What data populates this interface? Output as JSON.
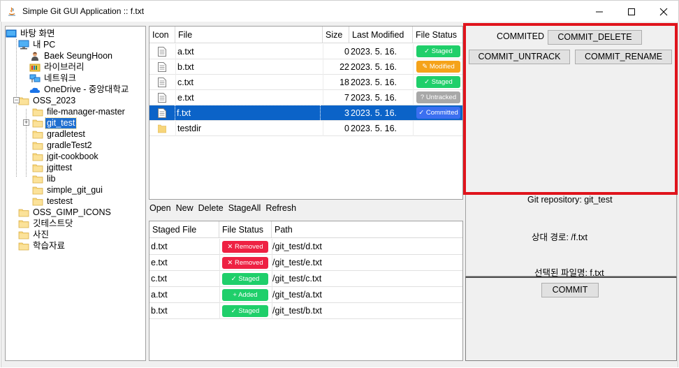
{
  "window": {
    "title": "Simple Git GUI Application :: f.txt",
    "controls": {
      "minimize": "minimize-icon",
      "maximize": "maximize-icon",
      "close": "close-icon"
    }
  },
  "tree": {
    "items": [
      {
        "label": "바탕 화면",
        "icon": "desktop-icon"
      },
      {
        "label": "내 PC",
        "icon": "computer-icon"
      },
      {
        "label": "Baek SeungHoon",
        "icon": "user-icon"
      },
      {
        "label": "라이브러리",
        "icon": "library-icon"
      },
      {
        "label": "네트워크",
        "icon": "network-icon"
      },
      {
        "label": "OneDrive - 중앙대학교",
        "icon": "cloud-icon"
      },
      {
        "label": "OSS_2023",
        "icon": "folder-icon"
      },
      {
        "label": "file-manager-master",
        "icon": "folder-icon"
      },
      {
        "label": "git_test",
        "icon": "folder-icon"
      },
      {
        "label": "gradletest",
        "icon": "folder-icon"
      },
      {
        "label": "gradleTest2",
        "icon": "folder-icon"
      },
      {
        "label": "jgit-cookbook",
        "icon": "folder-icon"
      },
      {
        "label": "jgittest",
        "icon": "folder-icon"
      },
      {
        "label": "lib",
        "icon": "folder-icon"
      },
      {
        "label": "simple_git_gui",
        "icon": "folder-icon"
      },
      {
        "label": "testest",
        "icon": "folder-icon"
      },
      {
        "label": "OSS_GIMP_ICONS",
        "icon": "folder-icon"
      },
      {
        "label": "깃테스트닷",
        "icon": "folder-icon"
      },
      {
        "label": "사진",
        "icon": "folder-icon"
      },
      {
        "label": "학습자료",
        "icon": "folder-icon"
      }
    ]
  },
  "files": {
    "headers": [
      "Icon",
      "File",
      "Size",
      "Last Modified",
      "File Status"
    ],
    "rows": [
      {
        "name": "a.txt",
        "size": "0",
        "modified": "2023. 5. 16.",
        "status": "Staged",
        "type": "file"
      },
      {
        "name": "b.txt",
        "size": "22",
        "modified": "2023. 5. 16.",
        "status": "Modified",
        "type": "file"
      },
      {
        "name": "c.txt",
        "size": "18",
        "modified": "2023. 5. 16.",
        "status": "Staged",
        "type": "file"
      },
      {
        "name": "e.txt",
        "size": "7",
        "modified": "2023. 5. 16.",
        "status": "Untracked",
        "type": "file"
      },
      {
        "name": "f.txt",
        "size": "3",
        "modified": "2023. 5. 16.",
        "status": "Committed",
        "type": "file"
      },
      {
        "name": "testdir",
        "size": "0",
        "modified": "2023. 5. 16.",
        "status": "",
        "type": "folder"
      }
    ]
  },
  "menu": {
    "items": [
      "Open",
      "New",
      "Delete",
      "StageAll",
      "Refresh"
    ]
  },
  "staged": {
    "headers": [
      "Staged File",
      "File Status",
      "Path"
    ],
    "rows": [
      {
        "file": "d.txt",
        "status": "Removed",
        "path": "/git_test/d.txt"
      },
      {
        "file": "e.txt",
        "status": "Removed",
        "path": "/git_test/e.txt"
      },
      {
        "file": "c.txt",
        "status": "Staged",
        "path": "/git_test/c.txt"
      },
      {
        "file": "a.txt",
        "status": "Added",
        "path": "/git_test/a.txt"
      },
      {
        "file": "b.txt",
        "status": "Staged",
        "path": "/git_test/b.txt"
      }
    ]
  },
  "status_styles": {
    "Staged": {
      "color": "#1fcf6a",
      "glyph": "✓"
    },
    "Modified": {
      "color": "#f5a31a",
      "glyph": "✎"
    },
    "Untracked": {
      "color": "#a8a8a8",
      "glyph": "?"
    },
    "Committed": {
      "color": "#3b6ff0",
      "glyph": "✓"
    },
    "Removed": {
      "color": "#ee2143",
      "glyph": "✕"
    },
    "Added": {
      "color": "#1fcf6a",
      "glyph": "+"
    }
  },
  "actions": {
    "status_label": "COMMITED",
    "commit_delete": "COMMIT_DELETE",
    "commit_untrack": "COMMIT_UNTRACK",
    "commit_rename": "COMMIT_RENAME"
  },
  "info": {
    "repo": "Git repository: git_test",
    "relative_path": "상대 경로: /f.txt",
    "selected_file": "선택된 파일명: f.txt"
  },
  "commit": {
    "button": "COMMIT"
  },
  "colors": {
    "selection": "#0b63c8",
    "highlight_border": "#e0141c"
  }
}
